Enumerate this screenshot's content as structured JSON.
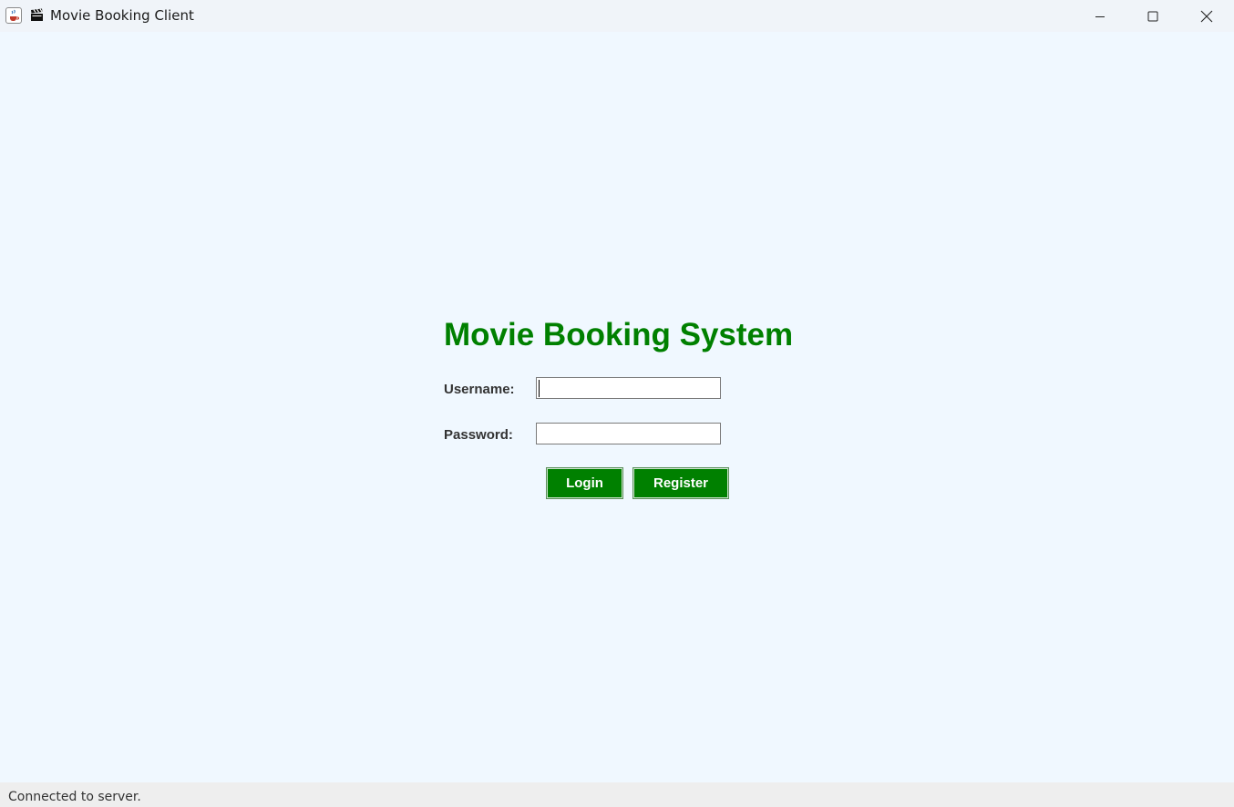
{
  "window": {
    "title": "Movie Booking Client",
    "app_icon": "java-cup-icon",
    "title_emoji": "clapper-board-icon",
    "controls": [
      "minimize-icon",
      "maximize-icon",
      "close-icon"
    ]
  },
  "login": {
    "heading": "Movie Booking System",
    "username_label": "Username:",
    "username_value": "",
    "password_label": "Password:",
    "password_value": "",
    "login_label": "Login",
    "register_label": "Register"
  },
  "status": {
    "text": "Connected to server."
  },
  "colors": {
    "accent": "#008000",
    "background": "#f0f8ff",
    "titlebar": "#f0f4f9",
    "statusbar": "#eeeeee"
  }
}
